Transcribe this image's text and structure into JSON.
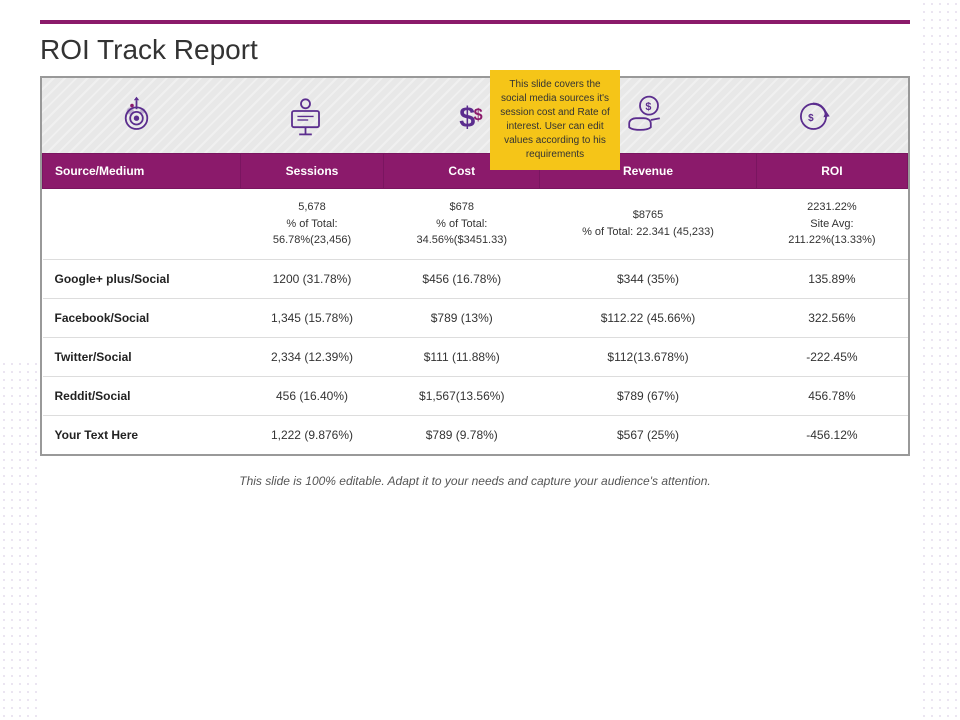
{
  "page": {
    "title": "ROI Track Report",
    "footer": "This slide is 100% editable. Adapt it to your needs and capture your audience's attention."
  },
  "callout": {
    "text": "This slide covers the social media sources it's session cost and Rate of interest. User can edit values according to his requirements"
  },
  "icons": [
    {
      "name": "target-icon",
      "label": "Target"
    },
    {
      "name": "presentation-icon",
      "label": "Presentation"
    },
    {
      "name": "dollar-icon",
      "label": "Dollar"
    },
    {
      "name": "revenue-icon",
      "label": "Revenue"
    },
    {
      "name": "roi-icon",
      "label": "ROI"
    }
  ],
  "table": {
    "headers": [
      "Source/Medium",
      "Sessions",
      "Cost",
      "Revenue",
      "ROI"
    ],
    "total_row": {
      "sessions": "5,678\n% of Total:\n56.78%(23,456)",
      "cost": "$678\n% of Total:\n34.56%($3451.33)",
      "revenue": "$8765\n% of Total: 22.341 (45,233)",
      "roi": "2231.22%\nSite Avg:\n211.22%(13.33%)"
    },
    "rows": [
      {
        "source": "Google+ plus/Social",
        "sessions": "1200 (31.78%)",
        "cost": "$456 (16.78%)",
        "revenue": "$344 (35%)",
        "roi": "135.89%"
      },
      {
        "source": "Facebook/Social",
        "sessions": "1,345 (15.78%)",
        "cost": "$789 (13%)",
        "revenue": "$112.22 (45.66%)",
        "roi": "322.56%"
      },
      {
        "source": "Twitter/Social",
        "sessions": "2,334 (12.39%)",
        "cost": "$111 (11.88%)",
        "revenue": "$112(13.678%)",
        "roi": "-222.45%"
      },
      {
        "source": "Reddit/Social",
        "sessions": "456 (16.40%)",
        "cost": "$1,567(13.56%)",
        "revenue": "$789 (67%)",
        "roi": "456.78%"
      },
      {
        "source": "Your Text Here",
        "sessions": "1,222 (9.876%)",
        "cost": "$789 (9.78%)",
        "revenue": "$567 (25%)",
        "roi": "-456.12%"
      }
    ]
  }
}
